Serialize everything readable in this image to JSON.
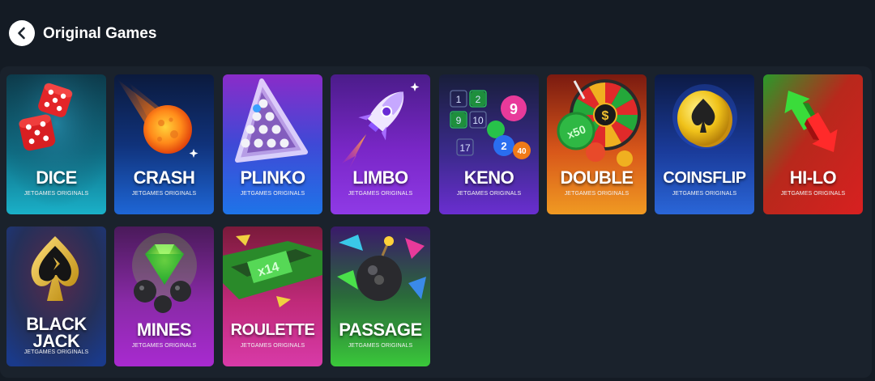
{
  "header": {
    "title": "Original Games"
  },
  "games": [
    {
      "name": "DICE",
      "subtitle": "JETGAMES ORIGINALS",
      "icon": "dice-icon"
    },
    {
      "name": "CRASH",
      "subtitle": "JETGAMES ORIGINALS",
      "icon": "meteor-icon"
    },
    {
      "name": "PLINKO",
      "subtitle": "JETGAMES ORIGINALS",
      "icon": "plinko-triangle-icon"
    },
    {
      "name": "LIMBO",
      "subtitle": "JETGAMES ORIGINALS",
      "icon": "rocket-icon"
    },
    {
      "name": "KENO",
      "subtitle": "JETGAMES ORIGINALS",
      "icon": "keno-balls-icon"
    },
    {
      "name": "DOUBLE",
      "subtitle": "JETGAMES ORIGINALS",
      "icon": "wheel-icon"
    },
    {
      "name": "COINSFLIP",
      "subtitle": "JETGAMES ORIGINALS",
      "icon": "coin-icon"
    },
    {
      "name": "HI-LO",
      "subtitle": "JETGAMES ORIGINALS",
      "icon": "arrows-icon"
    },
    {
      "name": "BLACK\nJACK",
      "subtitle": "JETGAMES ORIGINALS",
      "icon": "spade-icon"
    },
    {
      "name": "MINES",
      "subtitle": "JETGAMES ORIGINALS",
      "icon": "gem-bombs-icon"
    },
    {
      "name": "ROULETTE",
      "subtitle": "JETGAMES ORIGINALS",
      "icon": "roulette-icon"
    },
    {
      "name": "PASSAGE",
      "subtitle": "JETGAMES ORIGINALS",
      "icon": "bomb-icon"
    }
  ],
  "colors": {
    "background": "#141b24",
    "panel": "#1a222c"
  },
  "card_art": {
    "dice": "card labels and glyph art in markup",
    "chart_numbers": [
      "1",
      "2",
      "9",
      "10",
      "2",
      "17",
      "40"
    ],
    "double_coin": "x50",
    "roulette_tile": "x14"
  }
}
